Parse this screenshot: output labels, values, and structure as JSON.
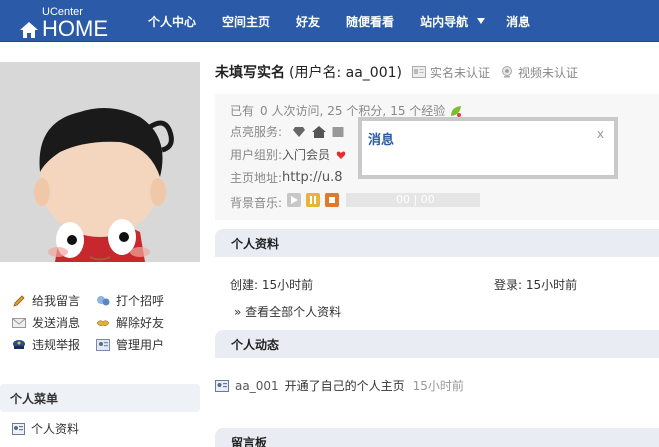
{
  "header": {
    "logo_small": "UCenter",
    "logo_big": "HOME",
    "nav": [
      "个人中心",
      "空间主页",
      "好友",
      "随便看看",
      "站内导航",
      "消息"
    ]
  },
  "actions": {
    "leave_message": "给我留言",
    "greet": "打个招呼",
    "send_message": "发送消息",
    "unfriend": "解除好友",
    "report": "违规举报",
    "manage_user": "管理用户"
  },
  "personal_menu": {
    "title": "个人菜单",
    "items": [
      "个人资料"
    ]
  },
  "profile": {
    "name": "未填写实名",
    "username_text": "(用户名: aa_001)",
    "realname_status": "实名未认证",
    "video_status": "视频未认证",
    "stats_prefix": "已有",
    "stats_visits": "0 人次访问,",
    "stats_points": "25 个积分,",
    "stats_exp": "15 个经验",
    "services_label": "点亮服务:",
    "group_label": "用户组别:",
    "group_value": "入门会员",
    "homepage_label": "主页地址:",
    "homepage_value": "http://u.8",
    "music_label": "背景音乐:",
    "music_time": "00 | 00"
  },
  "popup": {
    "title": "消息",
    "close": "x"
  },
  "sections": {
    "info_title": "个人资料",
    "created": "创建: 15小时前",
    "login": "登录: 15小时前",
    "view_all": "» 查看全部个人资料",
    "feed_title": "个人动态",
    "feed_user": "aa_001",
    "feed_text": "开通了自己的个人主页",
    "feed_time": "15小时前",
    "guestbook_title": "留言板"
  },
  "colors": {
    "header_bg": "#2a5aa8",
    "section_bar": "#e9edf3",
    "popup_title": "#2a5aa8"
  }
}
